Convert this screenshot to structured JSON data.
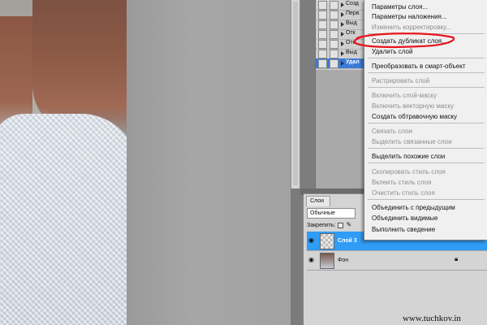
{
  "actions_panel": {
    "items": [
      {
        "label": "Созд"
      },
      {
        "label": "Перв"
      },
      {
        "label": "Выд"
      },
      {
        "label": "Отк"
      },
      {
        "label": "Отк"
      },
      {
        "label": "Выд"
      },
      {
        "label": "Удал",
        "selected": true
      }
    ]
  },
  "context_menu": {
    "items": [
      {
        "label": "Параметры слоя...",
        "enabled": true
      },
      {
        "label": "Параметры наложения...",
        "enabled": true
      },
      {
        "label": "Изменить корректировку...",
        "enabled": false
      },
      {
        "label": "Создать дубликат слоя...",
        "enabled": true,
        "highlighted_by_annotation": true
      },
      {
        "label": "Удалить слой",
        "enabled": true
      },
      {
        "label": "Преобразовать в смарт-объект",
        "enabled": true
      },
      {
        "label": "Растрировать слой",
        "enabled": false
      },
      {
        "label": "Включить слой-маску",
        "enabled": false
      },
      {
        "label": "Включить векторную маску",
        "enabled": false
      },
      {
        "label": "Создать обтравочную маску",
        "enabled": true
      },
      {
        "label": "Связать слои",
        "enabled": false
      },
      {
        "label": "Выделить связанные слои",
        "enabled": false
      },
      {
        "label": "Выделить похожие слои",
        "enabled": true
      },
      {
        "label": "Скопировать стиль слоя",
        "enabled": false
      },
      {
        "label": "Вклеить стиль слоя",
        "enabled": false
      },
      {
        "label": "Очистить стиль слоя",
        "enabled": false
      },
      {
        "label": "Объединить с предыдущим",
        "enabled": true
      },
      {
        "label": "Объединить видимые",
        "enabled": true
      },
      {
        "label": "Выполнить сведение",
        "enabled": true
      }
    ]
  },
  "layers_panel": {
    "tab_label": "Слои",
    "blend_mode": "Обычные",
    "lock_label": "Закрепить:",
    "layers": [
      {
        "name": "Слой 3",
        "selected": true,
        "visible": true
      },
      {
        "name": "Фон",
        "selected": false,
        "visible": true,
        "locked": true
      }
    ]
  },
  "annotation": {
    "color": "#e8141c",
    "shape": "ellipse"
  },
  "watermark": "www.tuchkov.in"
}
